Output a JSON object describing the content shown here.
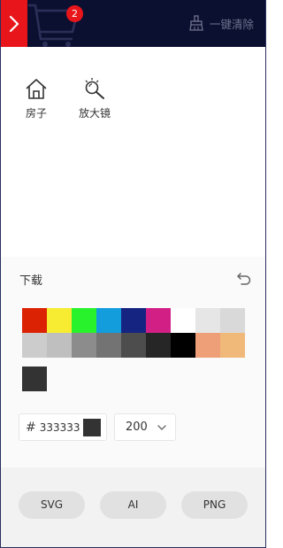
{
  "header": {
    "cart_count": "2",
    "clear_all_label": "一键清除",
    "colors": {
      "background": "#0c1030",
      "accent": "#e8161b"
    }
  },
  "tools": [
    {
      "label": "房子",
      "icon": "house-icon"
    },
    {
      "label": "放大镜",
      "icon": "magnifier-icon"
    }
  ],
  "download": {
    "title": "下载",
    "palette": [
      "#db2203",
      "#f7ec31",
      "#27f22c",
      "#139ddd",
      "#152480",
      "#d11f86",
      "#ffffff",
      "#e6e6e6",
      "#d9d9d9",
      "#cccccc",
      "#bfbfbf",
      "#8c8c8c",
      "#737373",
      "#4d4d4d",
      "#262626",
      "#000000",
      "#ef9f78",
      "#f0b879"
    ],
    "current_color": "#333333",
    "hex_prefix": "#",
    "hex_value": "333333",
    "size_value": "200"
  },
  "formats": [
    "SVG",
    "AI",
    "PNG"
  ]
}
